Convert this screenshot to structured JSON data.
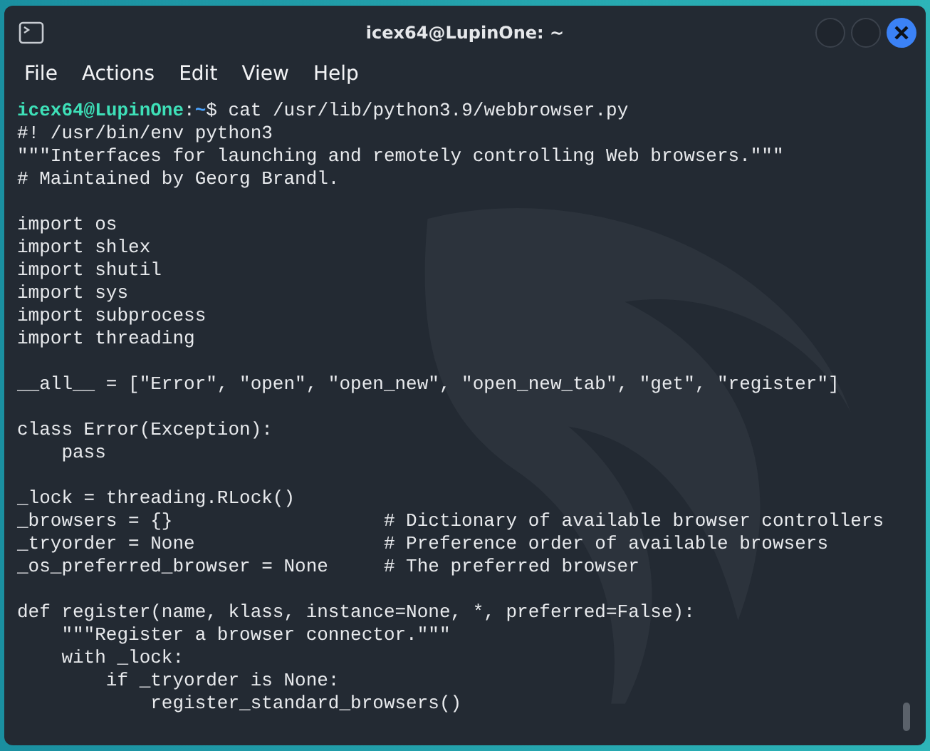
{
  "window": {
    "title": "icex64@LupinOne: ~"
  },
  "menu": [
    "File",
    "Actions",
    "Edit",
    "View",
    "Help"
  ],
  "terminal": {
    "prompt": {
      "user_host": "icex64@LupinOne",
      "separator": ":",
      "path": "~",
      "symbol": "$",
      "command": "cat /usr/lib/python3.9/webbrowser.py"
    },
    "lines": [
      {
        "kind": "text",
        "text": "#! /usr/bin/env python3"
      },
      {
        "kind": "text",
        "text": "\"\"\"Interfaces for launching and remotely controlling Web browsers.\"\"\""
      },
      {
        "kind": "text",
        "text": "# Maintained by Georg Brandl."
      },
      {
        "kind": "blank"
      },
      {
        "kind": "text",
        "text": "import os"
      },
      {
        "kind": "text",
        "text": "import shlex"
      },
      {
        "kind": "text",
        "text": "import shutil"
      },
      {
        "kind": "text",
        "text": "import sys"
      },
      {
        "kind": "text",
        "text": "import subprocess"
      },
      {
        "kind": "text",
        "text": "import threading"
      },
      {
        "kind": "blank"
      },
      {
        "kind": "text",
        "text": "__all__ = [\"Error\", \"open\", \"open_new\", \"open_new_tab\", \"get\", \"register\"]"
      },
      {
        "kind": "blank"
      },
      {
        "kind": "text",
        "text": "class Error(Exception):"
      },
      {
        "kind": "text",
        "text": "    pass"
      },
      {
        "kind": "blank"
      },
      {
        "kind": "text",
        "text": "_lock = threading.RLock()"
      },
      {
        "kind": "text",
        "text": "_browsers = {}                   # Dictionary of available browser controllers"
      },
      {
        "kind": "text",
        "text": "_tryorder = None                 # Preference order of available browsers"
      },
      {
        "kind": "text",
        "text": "_os_preferred_browser = None     # The preferred browser"
      },
      {
        "kind": "blank"
      },
      {
        "kind": "text",
        "text": "def register(name, klass, instance=None, *, preferred=False):"
      },
      {
        "kind": "text",
        "text": "    \"\"\"Register a browser connector.\"\"\""
      },
      {
        "kind": "text",
        "text": "    with _lock:"
      },
      {
        "kind": "text",
        "text": "        if _tryorder is None:"
      },
      {
        "kind": "text",
        "text": "            register_standard_browsers()"
      }
    ]
  }
}
